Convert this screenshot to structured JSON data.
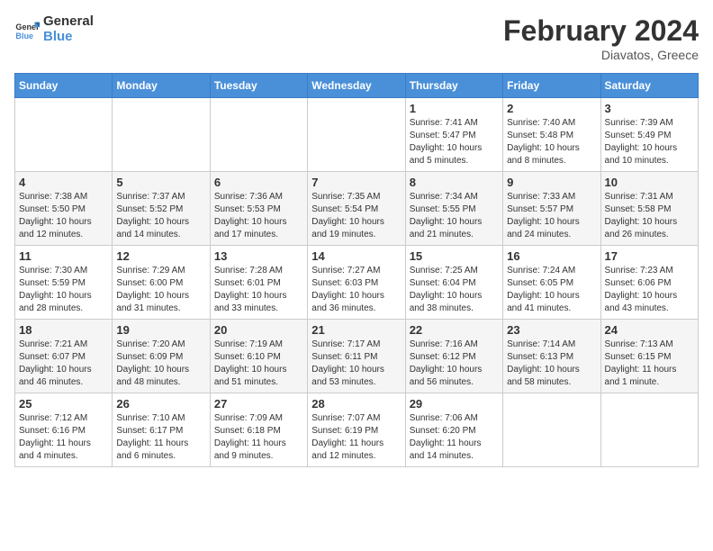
{
  "header": {
    "logo_general": "General",
    "logo_blue": "Blue",
    "month_title": "February 2024",
    "location": "Diavatos, Greece"
  },
  "weekdays": [
    "Sunday",
    "Monday",
    "Tuesday",
    "Wednesday",
    "Thursday",
    "Friday",
    "Saturday"
  ],
  "weeks": [
    [
      {
        "day": "",
        "info": ""
      },
      {
        "day": "",
        "info": ""
      },
      {
        "day": "",
        "info": ""
      },
      {
        "day": "",
        "info": ""
      },
      {
        "day": "1",
        "info": "Sunrise: 7:41 AM\nSunset: 5:47 PM\nDaylight: 10 hours\nand 5 minutes."
      },
      {
        "day": "2",
        "info": "Sunrise: 7:40 AM\nSunset: 5:48 PM\nDaylight: 10 hours\nand 8 minutes."
      },
      {
        "day": "3",
        "info": "Sunrise: 7:39 AM\nSunset: 5:49 PM\nDaylight: 10 hours\nand 10 minutes."
      }
    ],
    [
      {
        "day": "4",
        "info": "Sunrise: 7:38 AM\nSunset: 5:50 PM\nDaylight: 10 hours\nand 12 minutes."
      },
      {
        "day": "5",
        "info": "Sunrise: 7:37 AM\nSunset: 5:52 PM\nDaylight: 10 hours\nand 14 minutes."
      },
      {
        "day": "6",
        "info": "Sunrise: 7:36 AM\nSunset: 5:53 PM\nDaylight: 10 hours\nand 17 minutes."
      },
      {
        "day": "7",
        "info": "Sunrise: 7:35 AM\nSunset: 5:54 PM\nDaylight: 10 hours\nand 19 minutes."
      },
      {
        "day": "8",
        "info": "Sunrise: 7:34 AM\nSunset: 5:55 PM\nDaylight: 10 hours\nand 21 minutes."
      },
      {
        "day": "9",
        "info": "Sunrise: 7:33 AM\nSunset: 5:57 PM\nDaylight: 10 hours\nand 24 minutes."
      },
      {
        "day": "10",
        "info": "Sunrise: 7:31 AM\nSunset: 5:58 PM\nDaylight: 10 hours\nand 26 minutes."
      }
    ],
    [
      {
        "day": "11",
        "info": "Sunrise: 7:30 AM\nSunset: 5:59 PM\nDaylight: 10 hours\nand 28 minutes."
      },
      {
        "day": "12",
        "info": "Sunrise: 7:29 AM\nSunset: 6:00 PM\nDaylight: 10 hours\nand 31 minutes."
      },
      {
        "day": "13",
        "info": "Sunrise: 7:28 AM\nSunset: 6:01 PM\nDaylight: 10 hours\nand 33 minutes."
      },
      {
        "day": "14",
        "info": "Sunrise: 7:27 AM\nSunset: 6:03 PM\nDaylight: 10 hours\nand 36 minutes."
      },
      {
        "day": "15",
        "info": "Sunrise: 7:25 AM\nSunset: 6:04 PM\nDaylight: 10 hours\nand 38 minutes."
      },
      {
        "day": "16",
        "info": "Sunrise: 7:24 AM\nSunset: 6:05 PM\nDaylight: 10 hours\nand 41 minutes."
      },
      {
        "day": "17",
        "info": "Sunrise: 7:23 AM\nSunset: 6:06 PM\nDaylight: 10 hours\nand 43 minutes."
      }
    ],
    [
      {
        "day": "18",
        "info": "Sunrise: 7:21 AM\nSunset: 6:07 PM\nDaylight: 10 hours\nand 46 minutes."
      },
      {
        "day": "19",
        "info": "Sunrise: 7:20 AM\nSunset: 6:09 PM\nDaylight: 10 hours\nand 48 minutes."
      },
      {
        "day": "20",
        "info": "Sunrise: 7:19 AM\nSunset: 6:10 PM\nDaylight: 10 hours\nand 51 minutes."
      },
      {
        "day": "21",
        "info": "Sunrise: 7:17 AM\nSunset: 6:11 PM\nDaylight: 10 hours\nand 53 minutes."
      },
      {
        "day": "22",
        "info": "Sunrise: 7:16 AM\nSunset: 6:12 PM\nDaylight: 10 hours\nand 56 minutes."
      },
      {
        "day": "23",
        "info": "Sunrise: 7:14 AM\nSunset: 6:13 PM\nDaylight: 10 hours\nand 58 minutes."
      },
      {
        "day": "24",
        "info": "Sunrise: 7:13 AM\nSunset: 6:15 PM\nDaylight: 11 hours\nand 1 minute."
      }
    ],
    [
      {
        "day": "25",
        "info": "Sunrise: 7:12 AM\nSunset: 6:16 PM\nDaylight: 11 hours\nand 4 minutes."
      },
      {
        "day": "26",
        "info": "Sunrise: 7:10 AM\nSunset: 6:17 PM\nDaylight: 11 hours\nand 6 minutes."
      },
      {
        "day": "27",
        "info": "Sunrise: 7:09 AM\nSunset: 6:18 PM\nDaylight: 11 hours\nand 9 minutes."
      },
      {
        "day": "28",
        "info": "Sunrise: 7:07 AM\nSunset: 6:19 PM\nDaylight: 11 hours\nand 12 minutes."
      },
      {
        "day": "29",
        "info": "Sunrise: 7:06 AM\nSunset: 6:20 PM\nDaylight: 11 hours\nand 14 minutes."
      },
      {
        "day": "",
        "info": ""
      },
      {
        "day": "",
        "info": ""
      }
    ]
  ]
}
